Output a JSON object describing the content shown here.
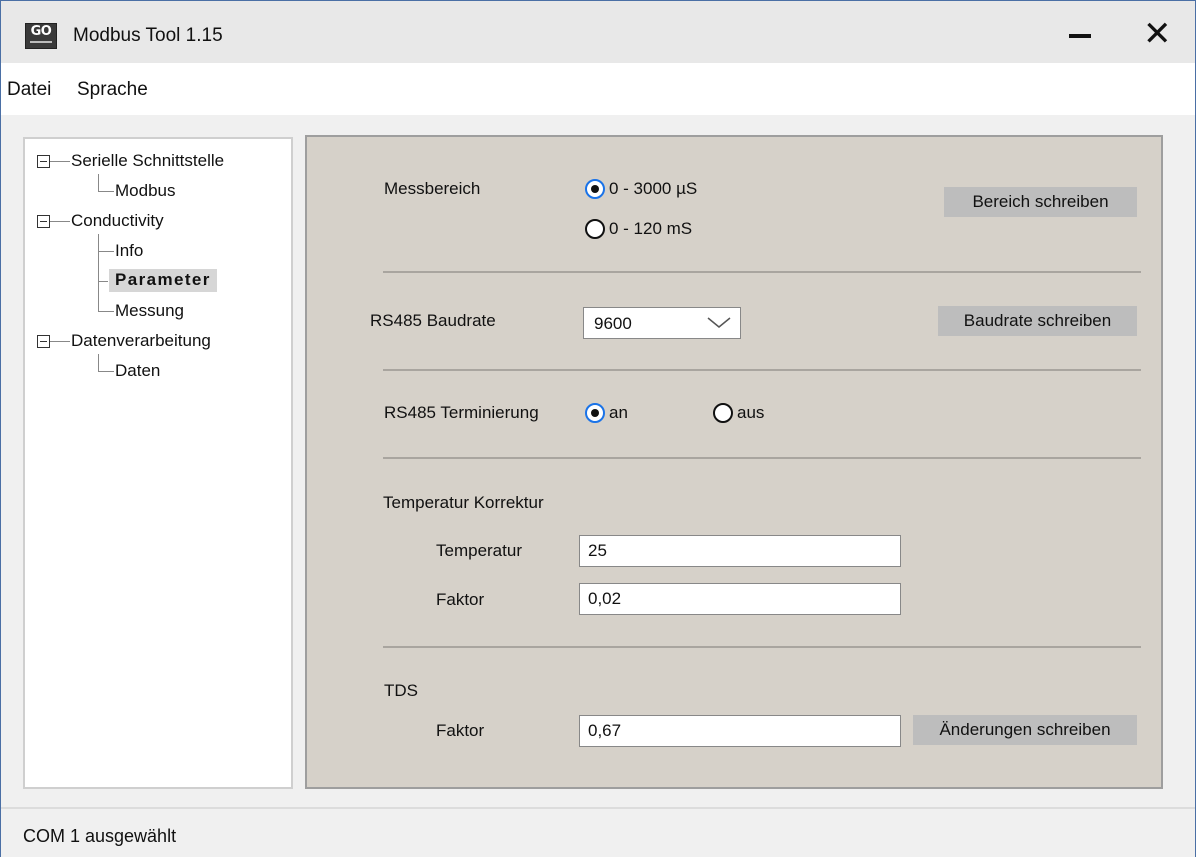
{
  "window": {
    "logo_text": "GO",
    "title": "Modbus Tool 1.15",
    "minimize_glyph": "–",
    "close_glyph": "✕"
  },
  "menu": {
    "items": [
      "Datei",
      "Sprache"
    ]
  },
  "tree": {
    "groups": [
      {
        "label": "Serielle Schnittstelle",
        "children": [
          "Modbus"
        ]
      },
      {
        "label": "Conductivity",
        "children": [
          "Info",
          "Parameter",
          "Messung"
        ]
      },
      {
        "label": "Datenverarbeitung",
        "children": [
          "Daten"
        ]
      }
    ],
    "selected": "Parameter"
  },
  "parameter": {
    "messbereich": {
      "label": "Messbereich",
      "options": [
        "0 - 3000 µS",
        "0 - 120 mS"
      ],
      "selected_index": 0,
      "button": "Bereich schreiben"
    },
    "baudrate": {
      "label": "RS485 Baudrate",
      "value": "9600",
      "button": "Baudrate schreiben"
    },
    "terminierung": {
      "label": "RS485 Terminierung",
      "options": [
        "an",
        "aus"
      ],
      "selected_index": 0
    },
    "temperatur_korrektur": {
      "heading": "Temperatur Korrektur",
      "temperatur_label": "Temperatur",
      "temperatur_value": "25",
      "faktor_label": "Faktor",
      "faktor_value": "0,02"
    },
    "tds": {
      "heading": "TDS",
      "faktor_label": "Faktor",
      "faktor_value": "0,67",
      "button": "Änderungen schreiben"
    }
  },
  "status": {
    "text": "COM 1 ausgewählt"
  },
  "colors": {
    "window_border": "#4a6fa5",
    "content_bg": "#d6d1c9",
    "radio_accent": "#1a73e8",
    "button_bg": "#bdbdbd"
  }
}
